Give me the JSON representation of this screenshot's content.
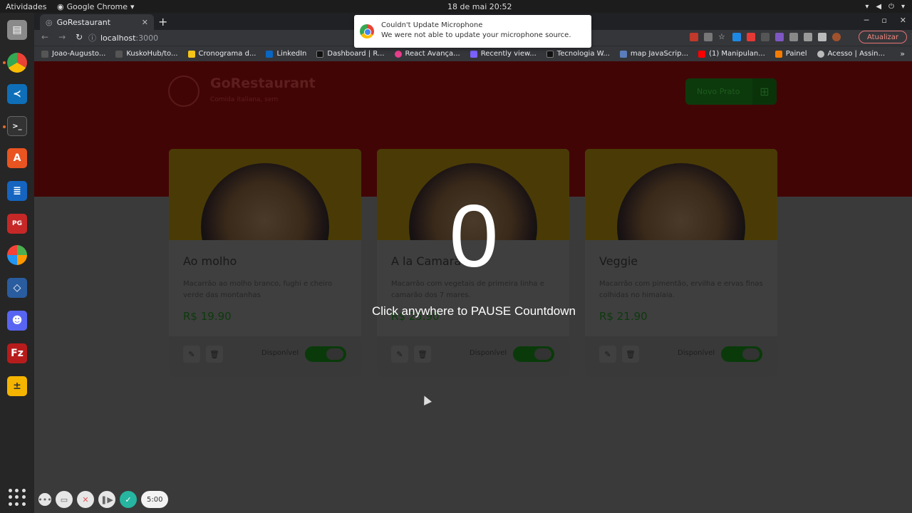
{
  "system": {
    "activities": "Atividades",
    "app_name": "Google Chrome",
    "clock": "18 de mai  20:52"
  },
  "browser": {
    "tab_title": "GoRestaurant",
    "url_host": "localhost",
    "url_port": ":3000",
    "update_label": "Atualizar",
    "bookmarks": [
      {
        "label": "Joao-Augusto...",
        "color": "#555555"
      },
      {
        "label": "KuskoHub/to...",
        "color": "#555555"
      },
      {
        "label": "Cronograma d...",
        "color": "#f5c518"
      },
      {
        "label": "LinkedIn",
        "color": "#0a66c2"
      },
      {
        "label": "Dashboard | R...",
        "color": "#111111"
      },
      {
        "label": "React Avança...",
        "color": "#e83e8c"
      },
      {
        "label": "Recently view...",
        "color": "#7b61ff"
      },
      {
        "label": "Tecnologia W...",
        "color": "#111111"
      },
      {
        "label": "map JavaScrip...",
        "color": "#5a7dbb"
      },
      {
        "label": "(1) Manipulan...",
        "color": "#ff0000"
      },
      {
        "label": "Painel",
        "color": "#f57c00"
      },
      {
        "label": "Acesso | Assin...",
        "color": "#bbbbbb"
      }
    ]
  },
  "notification": {
    "title": "Couldn't Update Microphone",
    "message": "We were not able to update your microphone source."
  },
  "app": {
    "brand": "GoRestaurant",
    "brand_sub": "Comida italiana, sem",
    "new_button": "Novo Prato",
    "available_label": "Disponível",
    "dishes": [
      {
        "name": "Ao molho",
        "description": "Macarrão ao molho branco, fughi e cheiro verde das montanhas",
        "price": "R$ 19.90"
      },
      {
        "name": "A la Camarão",
        "description": "Macarrão com vegetais de primeira linha e camarão dos 7 mares.",
        "price": "R$ 25.90"
      },
      {
        "name": "Veggie",
        "description": "Macarrão com pimentão, ervilha e ervas finas colhidas no himalaia.",
        "price": "R$ 21.90"
      }
    ]
  },
  "overlay": {
    "countdown": "0",
    "hint": "Click anywhere to PAUSE Countdown"
  },
  "recorder": {
    "timer": "5:00"
  }
}
